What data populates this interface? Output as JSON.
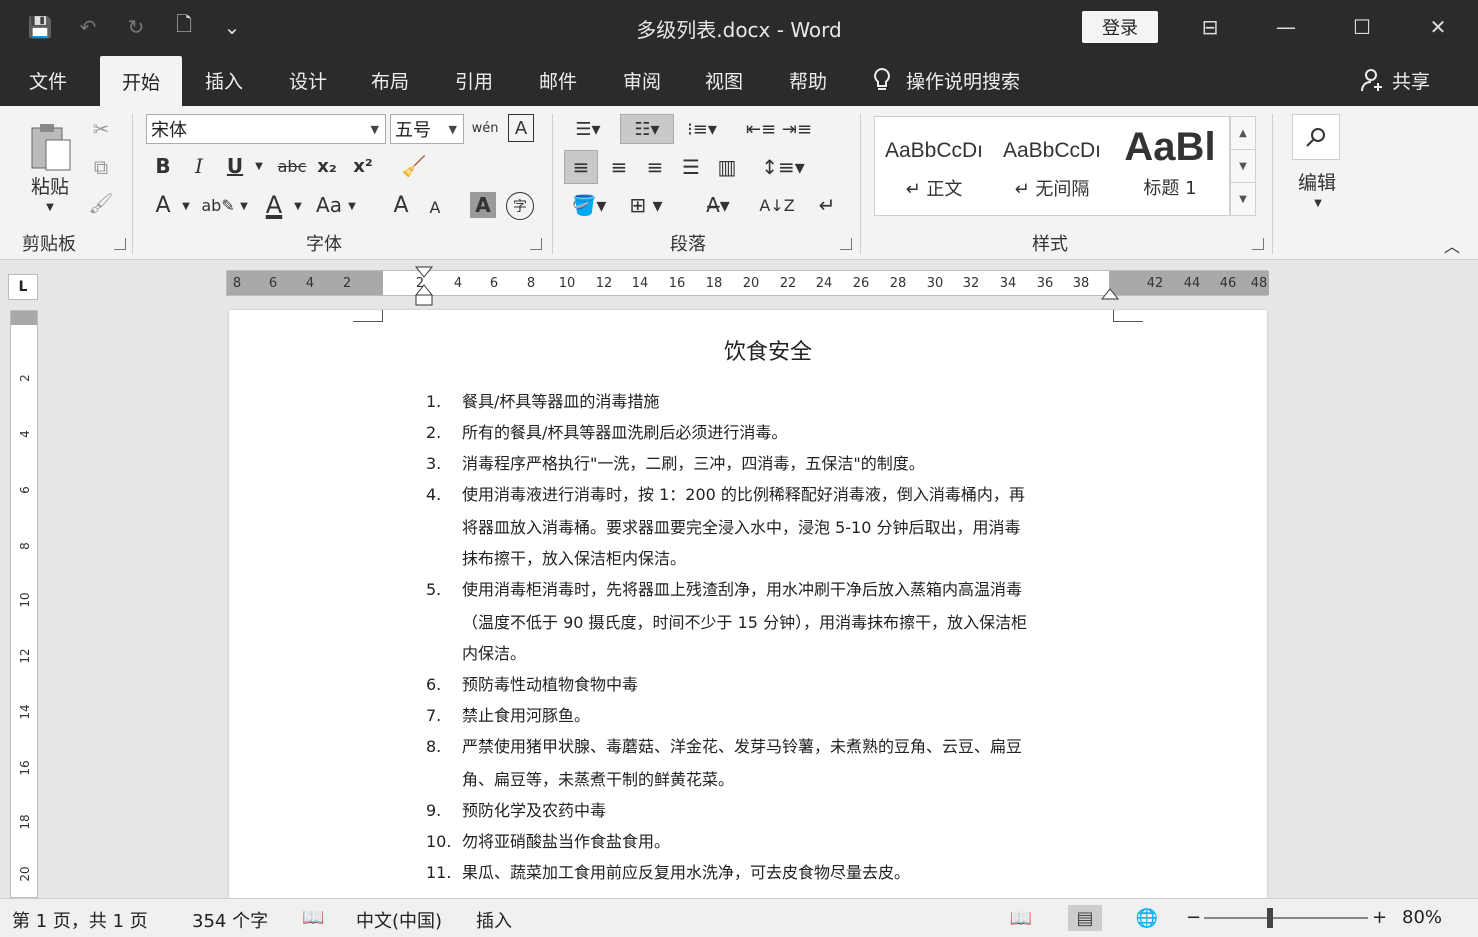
{
  "window": {
    "title": "多级列表.docx  -  Word",
    "login": "登录",
    "controls": [
      "⊟",
      "—",
      "☐",
      "✕"
    ]
  },
  "qat": {
    "save": "💾",
    "undo": "↶",
    "redo": "↻",
    "new": "🗋",
    "more": "⌄"
  },
  "tabs": [
    "文件",
    "开始",
    "插入",
    "设计",
    "布局",
    "引用",
    "邮件",
    "审阅",
    "视图",
    "帮助"
  ],
  "active_tab": "开始",
  "tell_me": "操作说明搜索",
  "share": "共享",
  "ribbon": {
    "clipboard": {
      "paste": "粘贴",
      "label": "剪贴板"
    },
    "font": {
      "font_name": "宋体",
      "font_size": "五号",
      "label": "字体",
      "bold": "B",
      "italic": "I",
      "underline": "U",
      "strike": "abc",
      "subscript": "x₂",
      "superscript": "x²",
      "grow": "A",
      "shrink": "A",
      "case": "Aa",
      "color": "A",
      "effects": "A",
      "phonetic": "wén",
      "border": "A",
      "enclose": "字"
    },
    "paragraph": {
      "label": "段落"
    },
    "styles": {
      "label": "样式",
      "items": [
        {
          "preview": "AaBbCcDı",
          "name": "↵ 正文"
        },
        {
          "preview": "AaBbCcDı",
          "name": "↵ 无间隔"
        },
        {
          "preview": "AaBl",
          "name": "标题 1"
        }
      ]
    },
    "editing": {
      "label": "编辑"
    }
  },
  "ruler": {
    "tab_selector": "L",
    "h_numbers": [
      "8",
      "6",
      "4",
      "2",
      "2",
      "4",
      "6",
      "8",
      "10",
      "12",
      "14",
      "16",
      "18",
      "20",
      "22",
      "24",
      "26",
      "28",
      "30",
      "32",
      "34",
      "36",
      "38",
      "42",
      "44",
      "46",
      "48"
    ],
    "v_numbers": [
      "2",
      "4",
      "6",
      "8",
      "10",
      "12",
      "14",
      "16",
      "18",
      "20"
    ]
  },
  "document": {
    "title": "饮食安全",
    "lines": [
      {
        "num": "1.",
        "text": "餐具/杯具等器皿的消毒措施"
      },
      {
        "num": "2.",
        "text": "所有的餐具/杯具等器皿洗刷后必须进行消毒。"
      },
      {
        "num": "3.",
        "text": "消毒程序严格执行\"一洗，二刷，三冲，四消毒，五保洁\"的制度。"
      },
      {
        "num": "4.",
        "text": "使用消毒液进行消毒时，按 1：200 的比例稀释配好消毒液，倒入消毒桶内，再"
      },
      {
        "num": "",
        "text": "将器皿放入消毒桶。要求器皿要完全浸入水中，浸泡 5-10 分钟后取出，用消毒"
      },
      {
        "num": "",
        "text": "抹布擦干，放入保洁柜内保洁。"
      },
      {
        "num": "5.",
        "text": "使用消毒柜消毒时，先将器皿上残渣刮净，用水冲刷干净后放入蒸箱内高温消毒"
      },
      {
        "num": "",
        "text": "（温度不低于 90 摄氏度，时间不少于 15 分钟），用消毒抹布擦干，放入保洁柜"
      },
      {
        "num": "",
        "text": "内保洁。"
      },
      {
        "num": "6.",
        "text": "预防毒性动植物食物中毒"
      },
      {
        "num": "7.",
        "text": "禁止食用河豚鱼。"
      },
      {
        "num": "8.",
        "text": "严禁使用猪甲状腺、毒蘑菇、洋金花、发芽马铃薯，未煮熟的豆角、云豆、扁豆"
      },
      {
        "num": "",
        "text": "角、扁豆等，未蒸煮干制的鲜黄花菜。"
      },
      {
        "num": "9.",
        "text": "预防化学及农药中毒"
      },
      {
        "num": "10.",
        "text": "勿将亚硝酸盐当作食盐食用。"
      },
      {
        "num": "11.",
        "text": "果瓜、蔬菜加工食用前应反复用水洗净，可去皮食物尽量去皮。"
      }
    ]
  },
  "status": {
    "page": "第 1 页，共 1 页",
    "words": "354 个字",
    "language": "中文(中国)",
    "mode": "插入",
    "zoom": "80%",
    "zoom_fraction": 0.4
  }
}
